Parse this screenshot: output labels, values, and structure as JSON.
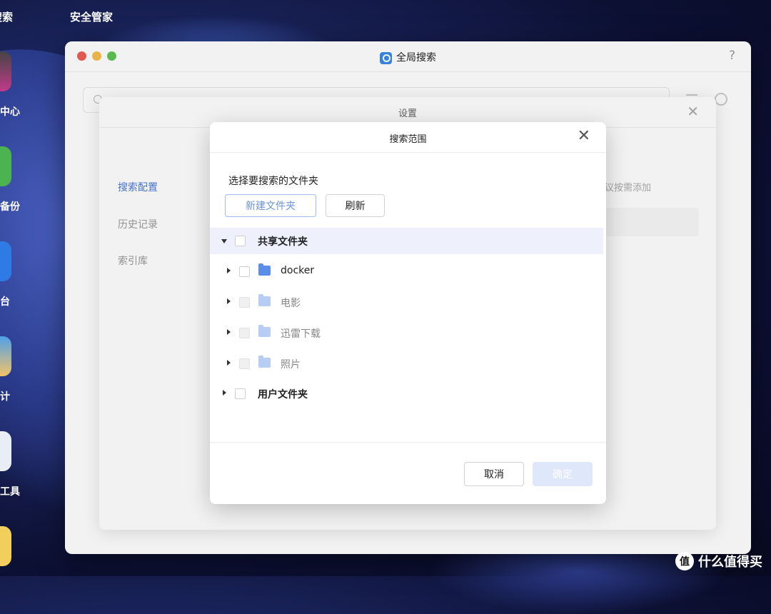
{
  "menu": {
    "left_partial": "搜索",
    "app": "安全管家"
  },
  "dock": {
    "labels": [
      "中心",
      "备份",
      "台",
      "计",
      "工具"
    ]
  },
  "window": {
    "title": "全局搜索",
    "help": "?"
  },
  "settings": {
    "title": "设置",
    "close": "✕",
    "sidebar": [
      "搜索配置",
      "历史记录",
      "索引库"
    ],
    "hint": "议按需添加"
  },
  "dialog": {
    "title": "搜索范围",
    "close": "✕",
    "prompt": "选择要搜索的文件夹",
    "new_folder": "新建文件夹",
    "refresh": "刷新",
    "tree": [
      {
        "label": "共享文件夹"
      },
      {
        "label": "docker"
      },
      {
        "label": "电影"
      },
      {
        "label": "迅雷下载"
      },
      {
        "label": "照片"
      },
      {
        "label": "用户文件夹"
      }
    ],
    "cancel": "取消",
    "ok": "确定"
  },
  "watermark": {
    "logo": "值",
    "text": "什么值得买"
  }
}
